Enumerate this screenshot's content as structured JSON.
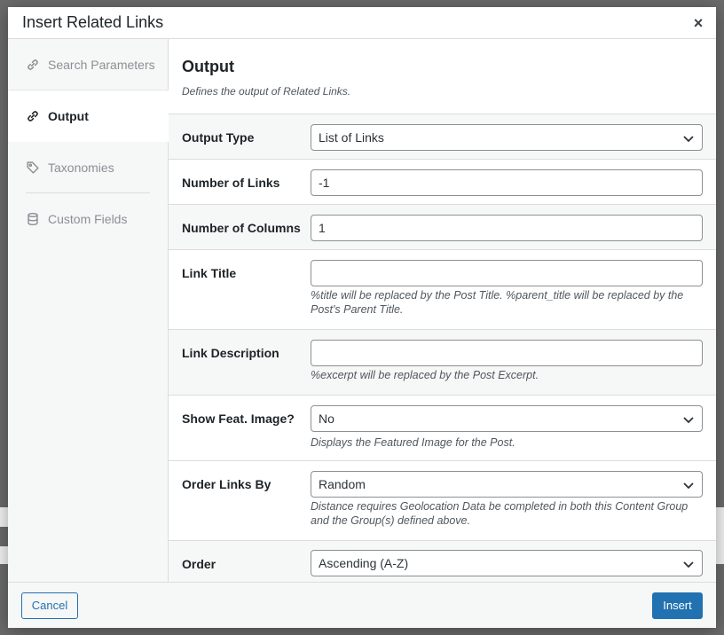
{
  "modal": {
    "title": "Insert Related Links",
    "close_glyph": "×"
  },
  "sidebar": {
    "items": [
      {
        "label": "Search Parameters",
        "icon": "link-icon",
        "active": false
      },
      {
        "label": "Output",
        "icon": "link-icon",
        "active": true
      },
      {
        "label": "Taxonomies",
        "icon": "tag-icon",
        "active": false
      },
      {
        "label": "Custom Fields",
        "icon": "database-icon",
        "active": false
      }
    ]
  },
  "section": {
    "title": "Output",
    "description": "Defines the output of Related Links."
  },
  "fields": {
    "output_type": {
      "label": "Output Type",
      "value": "List of Links"
    },
    "number_of_links": {
      "label": "Number of Links",
      "value": "-1"
    },
    "number_of_columns": {
      "label": "Number of Columns",
      "value": "1"
    },
    "link_title": {
      "label": "Link Title",
      "value": "",
      "help": "%title will be replaced by the Post Title. %parent_title will be replaced by the Post's Parent Title."
    },
    "link_description": {
      "label": "Link Description",
      "value": "",
      "help": "%excerpt will be replaced by the Post Excerpt."
    },
    "show_feat_image": {
      "label": "Show Feat. Image?",
      "value": "No",
      "help": "Displays the Featured Image for the Post."
    },
    "order_links_by": {
      "label": "Order Links By",
      "value": "Random",
      "help": "Distance requires Geolocation Data be completed in both this Content Group and the Group(s) defined above."
    },
    "order": {
      "label": "Order",
      "value": "Ascending (A-Z)"
    }
  },
  "footer": {
    "cancel_label": "Cancel",
    "insert_label": "Insert"
  },
  "colors": {
    "accent": "#2271b1",
    "text": "#1d2327",
    "muted": "#8c8f94",
    "panel": "#f6f7f7"
  }
}
